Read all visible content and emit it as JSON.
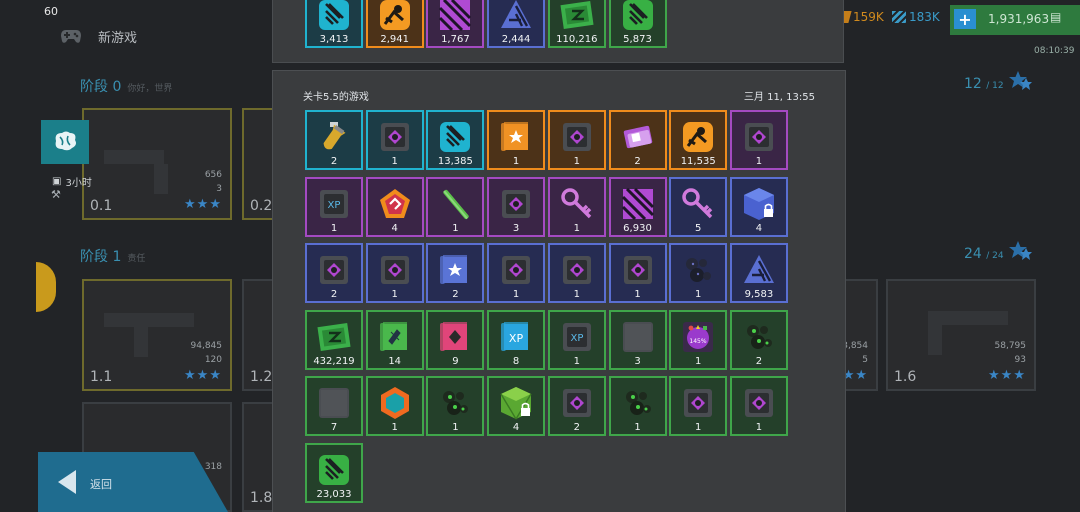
{
  "status": {
    "fps": "60"
  },
  "header": {
    "title": "新游戏",
    "gamepad_icon": "gamepad-icon"
  },
  "currency": {
    "gold": "159K",
    "parts": "183K",
    "cash": "1,931,963",
    "time": "08:10:39",
    "colors": {
      "gold": "#d08a1e",
      "parts": "#3a9bc8",
      "cash": "#2e7a3e"
    }
  },
  "stages": [
    {
      "title": "阶段 0",
      "subtitle": "你好，世界",
      "count": "12",
      "total": "/ 12"
    },
    {
      "title": "阶段 1",
      "subtitle": "责任",
      "count": "24",
      "total": "/ 24"
    }
  ],
  "levels": [
    {
      "num": "0.1",
      "value": "656",
      "stars_small": "3",
      "stars": "★★★"
    },
    {
      "num": "0.2"
    },
    {
      "num": "1.1",
      "value": "94,845",
      "stars_small": "120",
      "stars": "★★★"
    },
    {
      "num": "1.2"
    },
    {
      "num": "1.8"
    },
    {
      "value": "3,854",
      "stars_small": "5",
      "stars": "★★"
    },
    {
      "num": "1.6",
      "value": "58,795",
      "stars_small": "93",
      "stars": "★★★"
    },
    {
      "value": "318"
    }
  ],
  "side": {
    "timer": "3小时"
  },
  "back": {
    "label": "返回"
  },
  "panel_top_items": [
    {
      "icon": "cyan-ledger-icon",
      "qty": "3,413",
      "color": "cyan"
    },
    {
      "icon": "orange-mech-icon",
      "qty": "2,941",
      "color": "orange"
    },
    {
      "icon": "purple-stripes-icon",
      "qty": "1,767",
      "color": "purple"
    },
    {
      "icon": "blue-triangle-icon",
      "qty": "2,444",
      "color": "blue"
    },
    {
      "icon": "green-cash-icon",
      "qty": "110,216",
      "color": "green"
    },
    {
      "icon": "green-ledger-icon",
      "qty": "5,873",
      "color": "green"
    }
  ],
  "panel": {
    "title": "关卡5.5的游戏",
    "date": "三月 11, 13:55",
    "items": [
      {
        "icon": "vial-icon",
        "qty": "2",
        "color": "cyan"
      },
      {
        "icon": "chip-icon",
        "qty": "1",
        "color": "cyan"
      },
      {
        "icon": "cyan-ledger-icon",
        "qty": "13,385",
        "color": "cyan"
      },
      {
        "icon": "orange-blueprint-icon",
        "qty": "1",
        "color": "orange"
      },
      {
        "icon": "chip-icon",
        "qty": "1",
        "color": "orange"
      },
      {
        "icon": "purple-tickets-icon",
        "qty": "2",
        "color": "orange"
      },
      {
        "icon": "orange-mech-icon",
        "qty": "11,535",
        "color": "orange"
      },
      {
        "icon": "chip-icon",
        "qty": "1",
        "color": "purple"
      },
      {
        "icon": "xp-chip-icon",
        "qty": "1",
        "color": "purple"
      },
      {
        "icon": "pentagon-badge-icon",
        "qty": "4",
        "color": "purple"
      },
      {
        "icon": "green-rod-icon",
        "qty": "1",
        "color": "purple"
      },
      {
        "icon": "chip-icon",
        "qty": "3",
        "color": "purple"
      },
      {
        "icon": "key-icon",
        "qty": "1",
        "color": "purple"
      },
      {
        "icon": "purple-stripes-icon",
        "qty": "6,930",
        "color": "purple"
      },
      {
        "icon": "key-icon",
        "qty": "5",
        "color": "blue"
      },
      {
        "icon": "locked-cube-icon",
        "qty": "4",
        "color": "blue"
      },
      {
        "icon": "chip-icon",
        "qty": "2",
        "color": "blue"
      },
      {
        "icon": "chip-icon",
        "qty": "1",
        "color": "blue"
      },
      {
        "icon": "blue-blueprint-icon",
        "qty": "2",
        "color": "blue"
      },
      {
        "icon": "chip-icon",
        "qty": "1",
        "color": "blue"
      },
      {
        "icon": "chip-icon",
        "qty": "1",
        "color": "blue"
      },
      {
        "icon": "chip-icon",
        "qty": "1",
        "color": "blue"
      },
      {
        "icon": "dark-ore-icon",
        "qty": "1",
        "color": "blue"
      },
      {
        "icon": "blue-triangle-icon",
        "qty": "9,583",
        "color": "blue"
      },
      {
        "icon": "green-cash-icon",
        "qty": "432,219",
        "color": "green"
      },
      {
        "icon": "green-blueprint-icon",
        "qty": "14",
        "color": "green"
      },
      {
        "icon": "pink-blueprint-icon",
        "qty": "9",
        "color": "green"
      },
      {
        "icon": "xp-blueprint-icon",
        "qty": "8",
        "color": "green"
      },
      {
        "icon": "xp-chip-icon",
        "qty": "1",
        "color": "green"
      },
      {
        "icon": "empty-slot-icon",
        "qty": "3",
        "color": "green"
      },
      {
        "icon": "boost-card-icon",
        "qty": "1",
        "color": "green",
        "badge": "145%"
      },
      {
        "icon": "green-ore-icon",
        "qty": "2",
        "color": "green"
      },
      {
        "icon": "empty-slot-icon",
        "qty": "7",
        "color": "green"
      },
      {
        "icon": "hex-shield-icon",
        "qty": "1",
        "color": "green"
      },
      {
        "icon": "green-ore-icon",
        "qty": "1",
        "color": "green"
      },
      {
        "icon": "locked-crate-icon",
        "qty": "4",
        "color": "green"
      },
      {
        "icon": "chip-icon",
        "qty": "2",
        "color": "green"
      },
      {
        "icon": "green-ore-icon",
        "qty": "1",
        "color": "green"
      },
      {
        "icon": "chip-icon",
        "qty": "1",
        "color": "green"
      },
      {
        "icon": "chip-icon",
        "qty": "1",
        "color": "green"
      },
      {
        "icon": "green-ledger-icon",
        "qty": "23,033",
        "color": "green"
      }
    ]
  }
}
